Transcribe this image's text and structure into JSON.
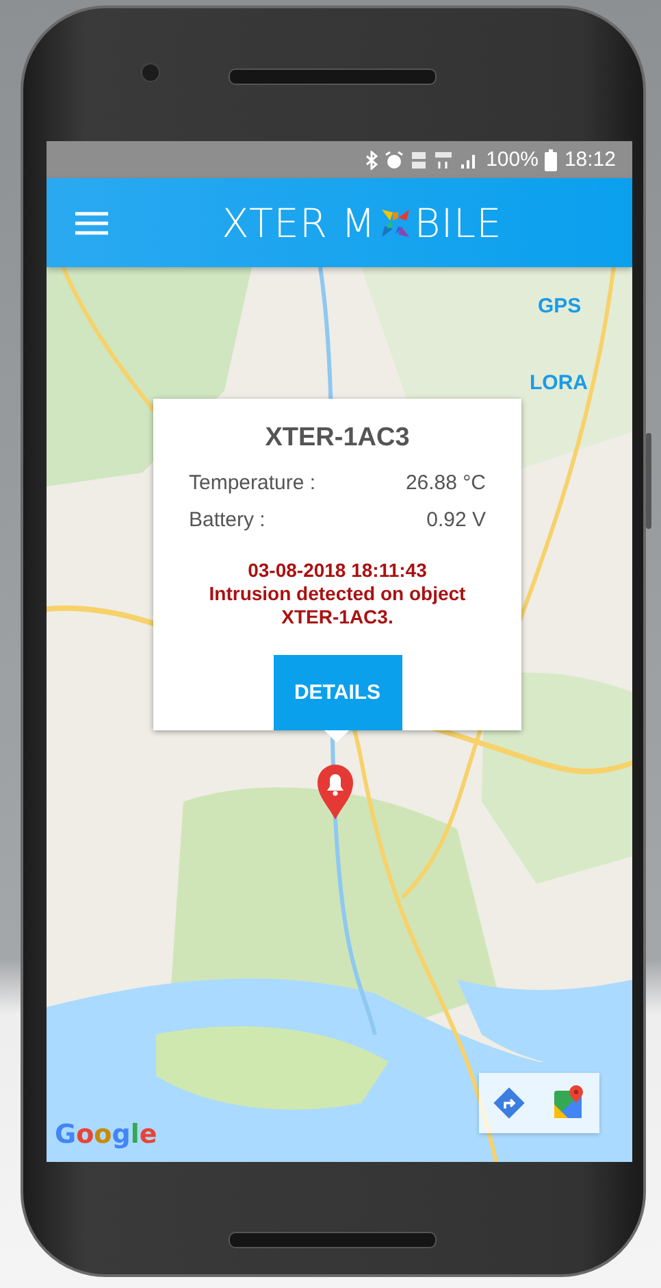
{
  "status_bar": {
    "battery_percent": "100%",
    "time": "18:12"
  },
  "app_bar": {
    "title_start": "XTER M",
    "title_end": "BILE"
  },
  "map_layers": [
    {
      "label": "GPS"
    },
    {
      "label": "LORA"
    }
  ],
  "popup": {
    "title": "XTER-1AC3",
    "readings": [
      {
        "label": "Temperature :",
        "value": "26.88 °C"
      },
      {
        "label": "Battery :",
        "value": "0.92 V"
      }
    ],
    "alert": {
      "time": "03-08-2018 18:11:43",
      "message": "Intrusion detected on object XTER-1AC3."
    },
    "button": "DETAILS"
  },
  "map_attribution": "Google"
}
